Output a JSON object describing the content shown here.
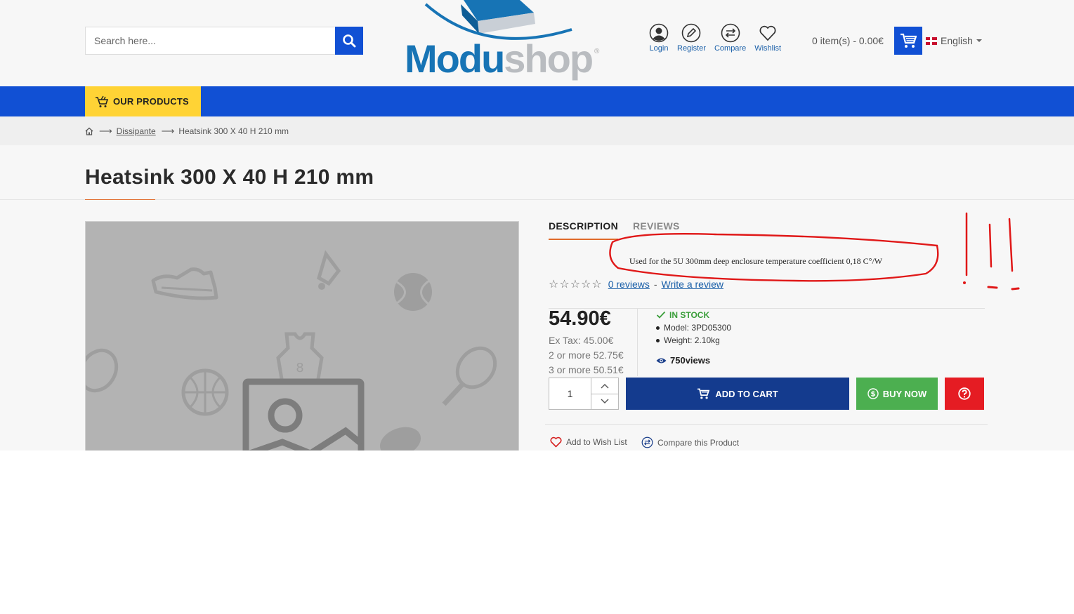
{
  "header": {
    "search_placeholder": "Search here...",
    "logo_part1": "Modu",
    "logo_part2": "shop",
    "logo_reg": "®",
    "user_links": [
      {
        "label": "Login",
        "icon": "user-icon"
      },
      {
        "label": "Register",
        "icon": "pencil-icon"
      },
      {
        "label": "Compare",
        "icon": "compare-icon"
      },
      {
        "label": "Wishlist",
        "icon": "heart-icon"
      }
    ],
    "cart_summary": "0 item(s) - 0.00€",
    "language": "English"
  },
  "nav": {
    "products_label": "OUR PRODUCTS"
  },
  "breadcrumb": {
    "category": "Dissipante",
    "current": "Heatsink 300 X 40 H 210 mm",
    "separator": "⟶"
  },
  "product": {
    "title": "Heatsink 300 X 40 H 210 mm",
    "tabs": [
      "DESCRIPTION",
      "REVIEWS"
    ],
    "description": "Used for the 5U 300mm deep enclosure temperature coefficient 0,18 C°/W",
    "stars": "☆☆☆☆☆",
    "reviews_link": "0 reviews",
    "rating_separator": "-",
    "write_review": "Write a review",
    "price": "54.90€",
    "ex_tax": "Ex Tax: 45.00€",
    "discounts": [
      "2 or more 52.75€",
      "3 or more 50.51€"
    ],
    "stock": "IN STOCK",
    "model": "Model: 3PD05300",
    "weight": "Weight: 2.10kg",
    "views": "750views",
    "quantity": "1",
    "add_to_cart": "ADD TO CART",
    "buy_now": "BUY NOW",
    "add_wishlist": "Add to Wish List",
    "compare_product": "Compare this Product"
  },
  "colors": {
    "primary_blue": "#1150d4",
    "nav_yellow": "#ffd335",
    "cart_button": "#143b8e",
    "buy_green": "#4caf50",
    "question_red": "#e51c23",
    "accent_orange": "#e06a2a",
    "annotation_red": "#e01818"
  }
}
